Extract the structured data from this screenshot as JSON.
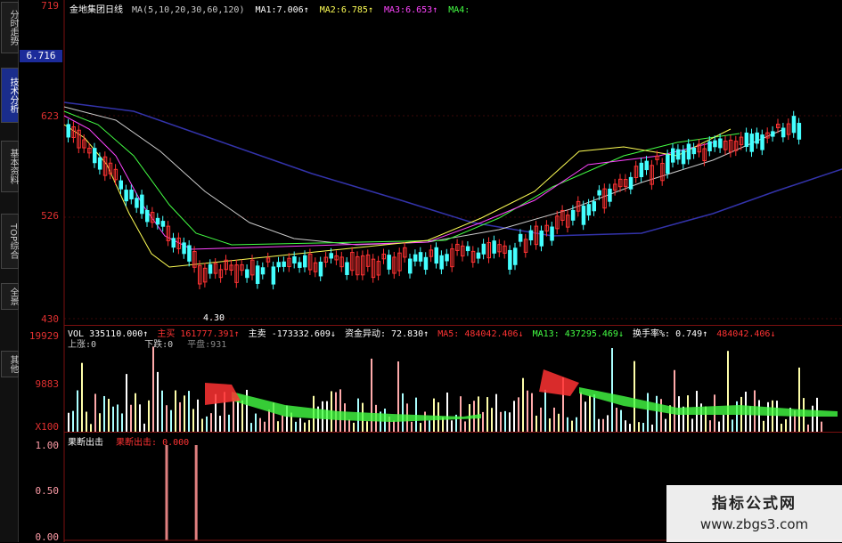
{
  "tabs": [
    "分时走势",
    "技术分析",
    "基本资料",
    "TOP综合",
    "全景",
    "其他"
  ],
  "active_tab": 1,
  "kline": {
    "title": "金地集团日线",
    "ma_params": "MA(5,10,20,30,60,120)",
    "ma1_label": "MA1:",
    "ma1_value": "7.006↑",
    "ma2_label": "MA2:",
    "ma2_value": "6.785↑",
    "ma3_label": "MA3:",
    "ma3_value": "6.653↑",
    "ma4_label": "MA4:",
    "current_price": "6.716",
    "low_marker": "4.30",
    "axis_labels": [
      "719",
      "623",
      "526",
      "430"
    ]
  },
  "volume": {
    "vol_label": "VOL",
    "vol_value": "335110.000↑",
    "main_buy_label": "主买",
    "main_buy_value": "161777.391↑",
    "main_sell_label": "主卖",
    "main_sell_value": "-173332.609↓",
    "fund_flow_label": "资金异动:",
    "fund_flow_value": "72.830↑",
    "ma5_label": "MA5:",
    "ma5_value": "484042.406↓",
    "ma13_label": "MA13:",
    "ma13_value": "437295.469↓",
    "turnover_label": "换手率%:",
    "turnover_value": "0.749↑",
    "turnover_extra": "484042.406↓",
    "rise_label": "上涨:0",
    "fall_label": "下跌:0",
    "flat_label": "平盘:931",
    "axis_labels": [
      "19929",
      "9883",
      "X100"
    ]
  },
  "signal": {
    "title": "果断出击",
    "value_label": "果断出击:",
    "value": "0.000",
    "axis_labels": [
      "1.00",
      "0.50",
      "0.00"
    ],
    "spikes_x_frac": [
      0.13,
      0.168
    ]
  },
  "watermark": {
    "title": "指标公式网",
    "url": "www.zbgs3.com"
  },
  "colors": {
    "ma1": "#ffffff",
    "ma2": "#ffff55",
    "ma3": "#ff44ff",
    "ma4": "#44ff44",
    "ma60": "#3333aa",
    "up": "#ff3333",
    "down": "#44ffff",
    "axis": "#e03030"
  }
}
